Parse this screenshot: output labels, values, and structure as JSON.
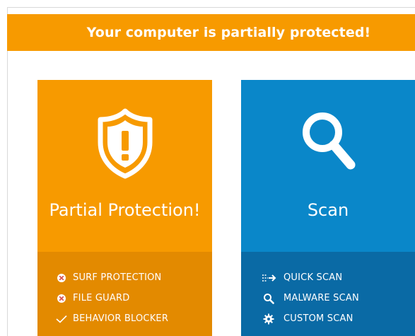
{
  "banner": {
    "text": "Your computer is partially protected!"
  },
  "protection_tile": {
    "title": "Partial Protection!",
    "icon": "shield-exclamation-icon",
    "items": [
      {
        "label": "SURF PROTECTION",
        "status": "disabled",
        "icon": "x-circle-icon"
      },
      {
        "label": "FILE GUARD",
        "status": "disabled",
        "icon": "x-circle-icon"
      },
      {
        "label": "BEHAVIOR BLOCKER",
        "status": "enabled",
        "icon": "check-icon"
      }
    ]
  },
  "scan_tile": {
    "title": "Scan",
    "icon": "magnifier-icon",
    "items": [
      {
        "label": "QUICK SCAN",
        "icon": "quick-arrow-icon"
      },
      {
        "label": "MALWARE SCAN",
        "icon": "magnifier-icon"
      },
      {
        "label": "CUSTOM SCAN",
        "icon": "gear-icon"
      }
    ]
  },
  "colors": {
    "orange": "#f79a00",
    "orange_dark": "#e38a00",
    "blue": "#0a87c9",
    "blue_dark": "#0a6aa5"
  }
}
